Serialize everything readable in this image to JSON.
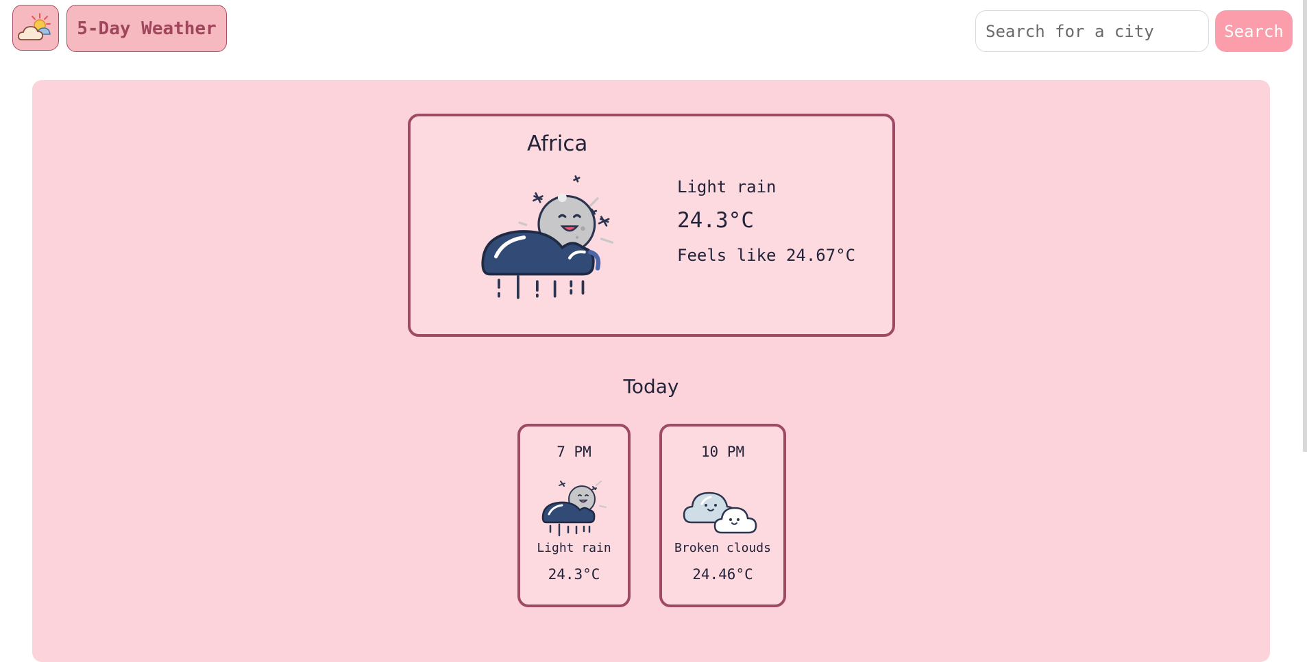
{
  "header": {
    "app_title": "5-Day Weather",
    "logo_icon": "partly-cloudy-sun-icon",
    "search": {
      "placeholder": "Search for a city",
      "value": "",
      "button_label": "Search"
    }
  },
  "current": {
    "city": "Africa",
    "icon": "moon-light-rain-icon",
    "condition": "Light rain",
    "temperature": "24.3°C",
    "feels_like": "Feels like 24.67°C"
  },
  "today": {
    "heading": "Today",
    "hours": [
      {
        "time": "7 PM",
        "icon": "moon-light-rain-icon",
        "description": "Light rain",
        "temperature": "24.3°C"
      },
      {
        "time": "10 PM",
        "icon": "broken-clouds-icon",
        "description": "Broken clouds",
        "temperature": "24.46°C"
      }
    ]
  },
  "colors": {
    "accent": "#fb9dab",
    "panel": "#fcd3da",
    "card_border": "#9f4a65",
    "title_text": "#a0465c"
  }
}
